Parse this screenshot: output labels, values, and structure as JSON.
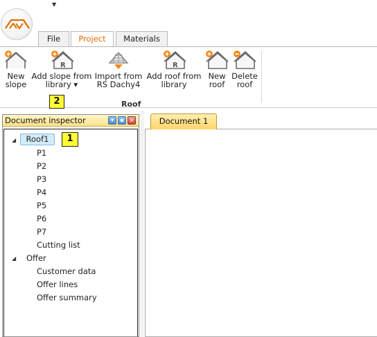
{
  "app": {
    "logo_icon": "roof-logo-icon",
    "quick_access_icon": "customize-arrow-icon",
    "accent_color": "#e06d00"
  },
  "tabs": [
    {
      "label": "File"
    },
    {
      "label": "Project"
    },
    {
      "label": "Materials"
    }
  ],
  "ribbon": {
    "group_label": "Roof",
    "buttons": [
      {
        "line1": "New",
        "line2": "slope",
        "icon": "new-slope-icon"
      },
      {
        "line1": "Add slope from",
        "line2": "library ▾",
        "icon": "add-slope-from-library-icon"
      },
      {
        "line1": "Import from",
        "line2": "RS Dachy4",
        "icon": "import-icon"
      },
      {
        "line1": "Add roof from",
        "line2": "library",
        "icon": "add-roof-from-library-icon"
      },
      {
        "line1": "New",
        "line2": "roof",
        "icon": "new-roof-icon"
      },
      {
        "line1": "Delete",
        "line2": "roof",
        "icon": "delete-roof-icon"
      }
    ]
  },
  "annotations": {
    "badge_1": "1",
    "badge_2": "2"
  },
  "inspector": {
    "title": "Document inspector",
    "tree": {
      "roof": {
        "label": "Roof1",
        "children": [
          "P1",
          "P2",
          "P3",
          "P4",
          "P5",
          "P6",
          "P7",
          "Cutting list"
        ]
      },
      "offer": {
        "label": "Offer",
        "children": [
          "Customer data",
          "Offer lines",
          "Offer summary"
        ]
      }
    }
  },
  "document": {
    "tab_label": "Document 1"
  }
}
